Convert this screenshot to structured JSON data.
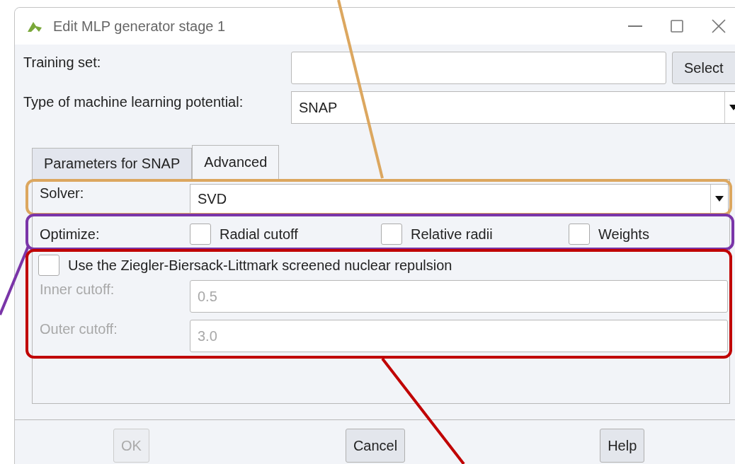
{
  "window": {
    "title": "Edit MLP generator stage 1"
  },
  "training_set": {
    "label": "Training set:",
    "button": "Select"
  },
  "potential_type": {
    "label": "Type of machine learning potential:",
    "value": "SNAP"
  },
  "tabs": [
    {
      "label": "Parameters for SNAP",
      "selected": false
    },
    {
      "label": "Advanced",
      "selected": true
    }
  ],
  "solver": {
    "label": "Solver:",
    "value": "SVD"
  },
  "optimize": {
    "label": "Optimize:",
    "options": [
      {
        "label": "Radial cutoff",
        "checked": false
      },
      {
        "label": "Relative radii",
        "checked": false
      },
      {
        "label": "Weights",
        "checked": false
      }
    ]
  },
  "zbl": {
    "label": "Use the Ziegler-Biersack-Littmark screened nuclear repulsion",
    "checked": false
  },
  "cutoffs": [
    {
      "label": "Inner cutoff:",
      "value": "0.5",
      "disabled": true
    },
    {
      "label": "Outer cutoff:",
      "value": "3.0",
      "disabled": true
    }
  ],
  "buttons": [
    {
      "label": "OK",
      "disabled": true
    },
    {
      "label": "Cancel",
      "disabled": false
    },
    {
      "label": "Help",
      "disabled": false
    }
  ],
  "annotations": [
    {
      "color": "#dca75f"
    },
    {
      "color": "#7a35a8"
    },
    {
      "color": "#c00000"
    }
  ]
}
